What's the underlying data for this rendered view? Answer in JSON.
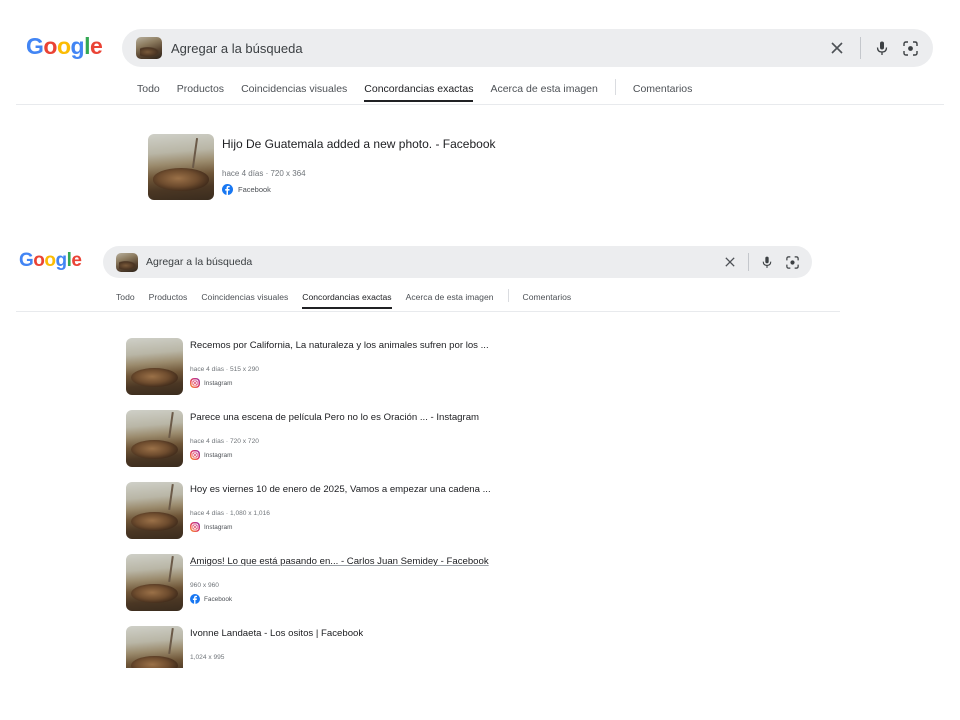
{
  "logo": {
    "letters": [
      "G",
      "o",
      "o",
      "g",
      "l",
      "e"
    ],
    "colors": [
      "#4285F4",
      "#EA4335",
      "#FBBC05",
      "#4285F4",
      "#34A853",
      "#EA4335"
    ]
  },
  "search": {
    "placeholder": "Agregar a la búsqueda"
  },
  "icons": {
    "clear": "close-icon",
    "voice": "microphone-icon",
    "lens": "lens-camera-icon",
    "facebook": "facebook-icon",
    "instagram": "instagram-icon"
  },
  "tabs": [
    {
      "label": "Todo"
    },
    {
      "label": "Productos"
    },
    {
      "label": "Coincidencias visuales"
    },
    {
      "label": "Concordancias exactas",
      "active": true
    },
    {
      "label": "Acerca de esta imagen"
    },
    {
      "label": "Comentarios"
    }
  ],
  "panel_a": {
    "results": [
      {
        "title": "Hijo De Guatemala added a new photo. - Facebook",
        "age": "hace 4 días",
        "size": "720 x 364",
        "source": "Facebook",
        "source_icon": "facebook"
      }
    ]
  },
  "panel_b": {
    "results": [
      {
        "title": "Recemos por California, La naturaleza y los animales sufren por los ...",
        "age": "hace 4 días",
        "size": "515 x 290",
        "source": "Instagram",
        "source_icon": "instagram"
      },
      {
        "title": "Parece una escena de película Pero no lo es Oración ... - Instagram",
        "age": "hace 4 días",
        "size": "720 x 720",
        "source": "Instagram",
        "source_icon": "instagram"
      },
      {
        "title": "Hoy es viernes 10 de enero de 2025, Vamos a empezar una cadena ...",
        "age": "hace 4 días",
        "size": "1,080 x 1,016",
        "source": "Instagram",
        "source_icon": "instagram"
      },
      {
        "title": "Amigos! Lo que está pasando en... - Carlos Juan Semidey - Facebook",
        "age": "",
        "size": "960 x 960",
        "source": "Facebook",
        "source_icon": "facebook"
      },
      {
        "title": "Ivonne Landaeta - Los ositos | Facebook",
        "age": "",
        "size": "1,024 x 995",
        "source": "",
        "source_icon": ""
      }
    ]
  }
}
